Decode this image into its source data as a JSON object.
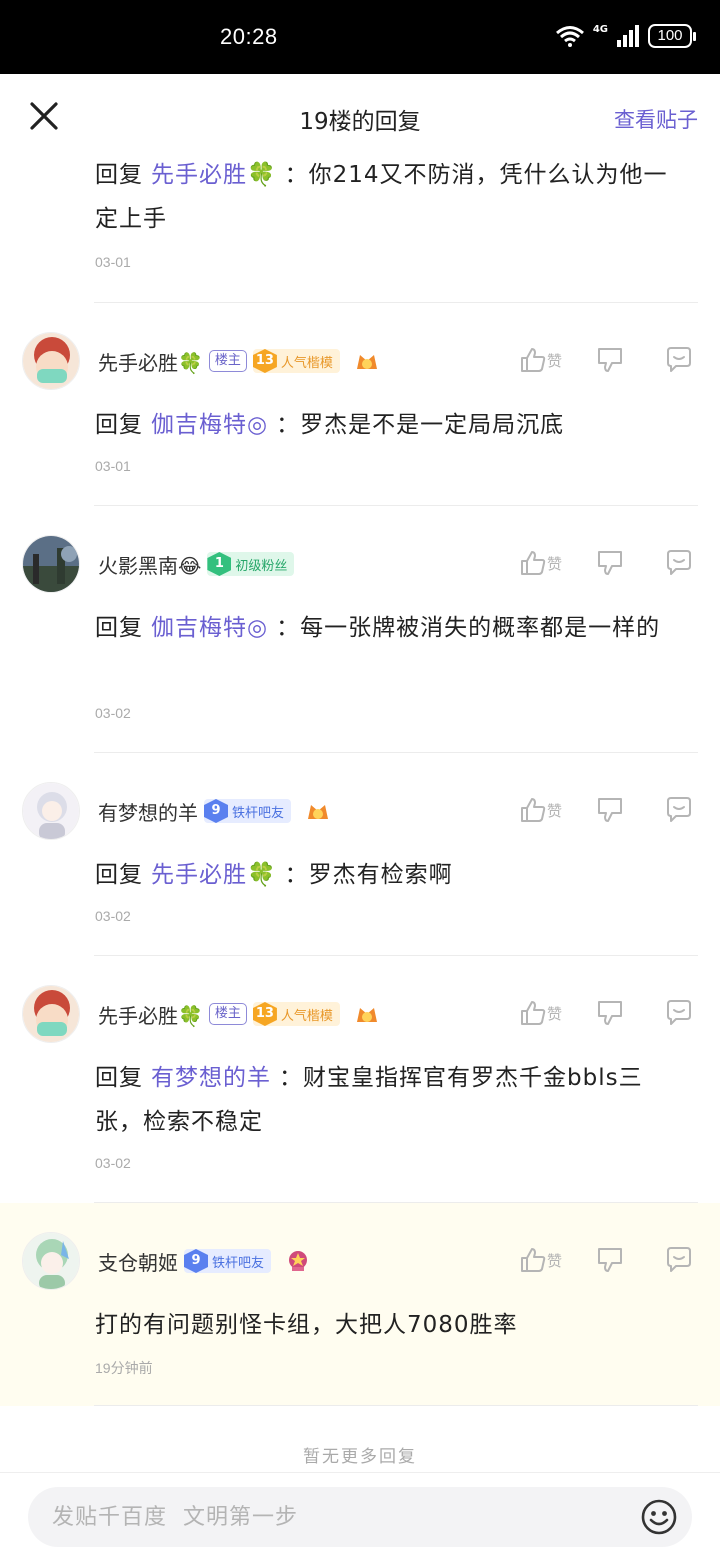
{
  "status_bar": {
    "time": "20:28",
    "network": "4G",
    "battery": "100"
  },
  "header": {
    "title": "19楼的回复",
    "view_post": "查看贴子"
  },
  "reply_prefix": "回复",
  "like_label": "赞",
  "first_reply": {
    "mention": "先手必胜🍀",
    "text": "：你214又不防消，凭什么认为他一定上手",
    "date": "03-01"
  },
  "replies": [
    {
      "username": "先手必胜🍀",
      "is_host": true,
      "host_label": "楼主",
      "level": "13",
      "level_title": "人气楷模",
      "level_color": "orange",
      "mention": "伽吉梅特◎",
      "text": "：罗杰是不是一定局局沉底",
      "date": "03-01"
    },
    {
      "username": "火影黑南😂",
      "is_host": false,
      "level": "1",
      "level_title": "初级粉丝",
      "level_color": "green",
      "mention": "伽吉梅特◎",
      "text": "：每一张牌被消失的概率都是一样的",
      "date": "03-02"
    },
    {
      "username": "有梦想的羊",
      "is_host": false,
      "level": "9",
      "level_title": "铁杆吧友",
      "level_color": "blue",
      "mention": "先手必胜🍀",
      "text": "：罗杰有检索啊",
      "date": "03-02"
    },
    {
      "username": "先手必胜🍀",
      "is_host": true,
      "host_label": "楼主",
      "level": "13",
      "level_title": "人气楷模",
      "level_color": "orange",
      "mention": "有梦想的羊",
      "text": "：财宝皇指挥官有罗杰千金bbls三张，检索不稳定",
      "date": "03-02"
    },
    {
      "username": "支仓朝姬",
      "is_host": false,
      "level": "9",
      "level_title": "铁杆吧友",
      "level_color": "blue",
      "mention": "",
      "text": "打的有问题别怪卡组，大把人7080胜率",
      "date": "19分钟前",
      "highlight": true
    }
  ],
  "no_more": "暂无更多回复",
  "composer": {
    "placeholder": "发贴千百度  文明第一步"
  },
  "colors": {
    "accent": "#6a5fd1",
    "highlight_bg": "#fffdf0"
  }
}
